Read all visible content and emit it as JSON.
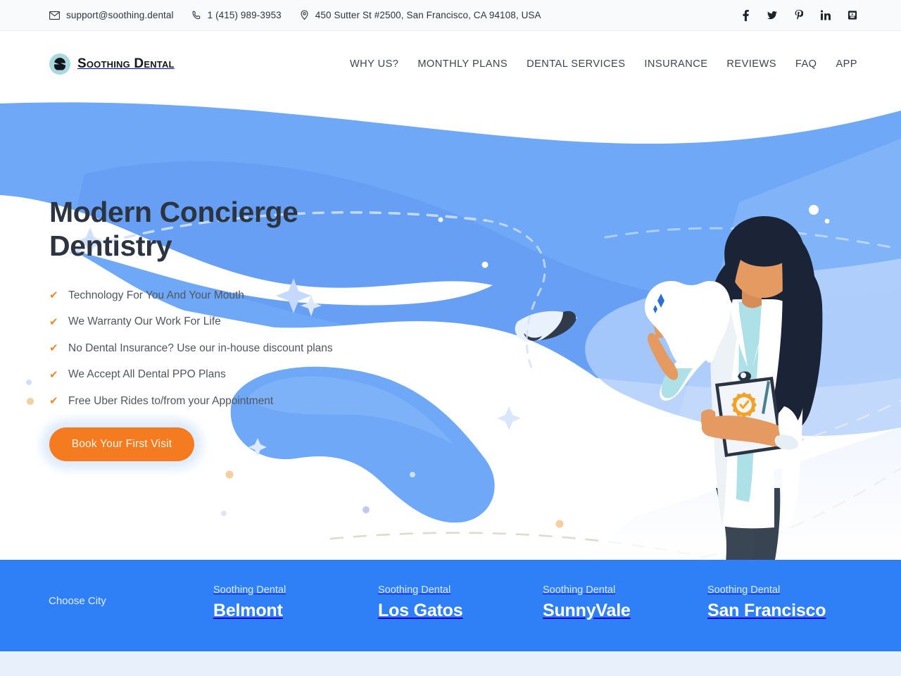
{
  "topbar": {
    "email": "support@soothing.dental",
    "phone": "1 (415) 989-3953",
    "address": "450 Sutter St #2500, San Francisco, CA 94108, USA",
    "social": [
      {
        "name": "facebook",
        "label": "f"
      },
      {
        "name": "twitter",
        "label": "t"
      },
      {
        "name": "pinterest",
        "label": "P"
      },
      {
        "name": "linkedin",
        "label": "in"
      },
      {
        "name": "youtube",
        "label": "yt"
      }
    ]
  },
  "header": {
    "brand": "Soothing Dental",
    "nav": [
      {
        "label": "WHY US?"
      },
      {
        "label": "MONTHLY PLANS"
      },
      {
        "label": "DENTAL SERVICES"
      },
      {
        "label": "INSURANCE"
      },
      {
        "label": "REVIEWS"
      },
      {
        "label": "FAQ"
      },
      {
        "label": "APP"
      }
    ]
  },
  "hero": {
    "title_line1": "Modern Concierge",
    "title_line2": "Dentistry",
    "features": [
      "Technology For You And Your Mouth",
      "We Warranty Our Work For Life",
      "No Dental Insurance? Use our in-house discount plans",
      "We Accept All Dental PPO Plans",
      "Free Uber Rides to/from your Appointment"
    ],
    "cta_label": "Book Your First Visit",
    "check_glyph": "✔"
  },
  "citybar": {
    "choose_label": "Choose City",
    "cities": [
      {
        "sub": "Soothing Dental",
        "name": "Belmont"
      },
      {
        "sub": "Soothing Dental",
        "name": "Los Gatos"
      },
      {
        "sub": "Soothing Dental",
        "name": "SunnyVale"
      },
      {
        "sub": "Soothing Dental",
        "name": "San Francisco"
      }
    ]
  },
  "colors": {
    "brand_blue": "#2f80f6",
    "hero_blue": "#6ea8f7",
    "hero_blue_light": "#9cc4fa",
    "accent_orange": "#f47b20",
    "check_orange": "#ef8a2b",
    "text_dark": "#2b3440",
    "topbar_bg": "#f9fafb",
    "bottom_strip": "#e8f0fb"
  }
}
